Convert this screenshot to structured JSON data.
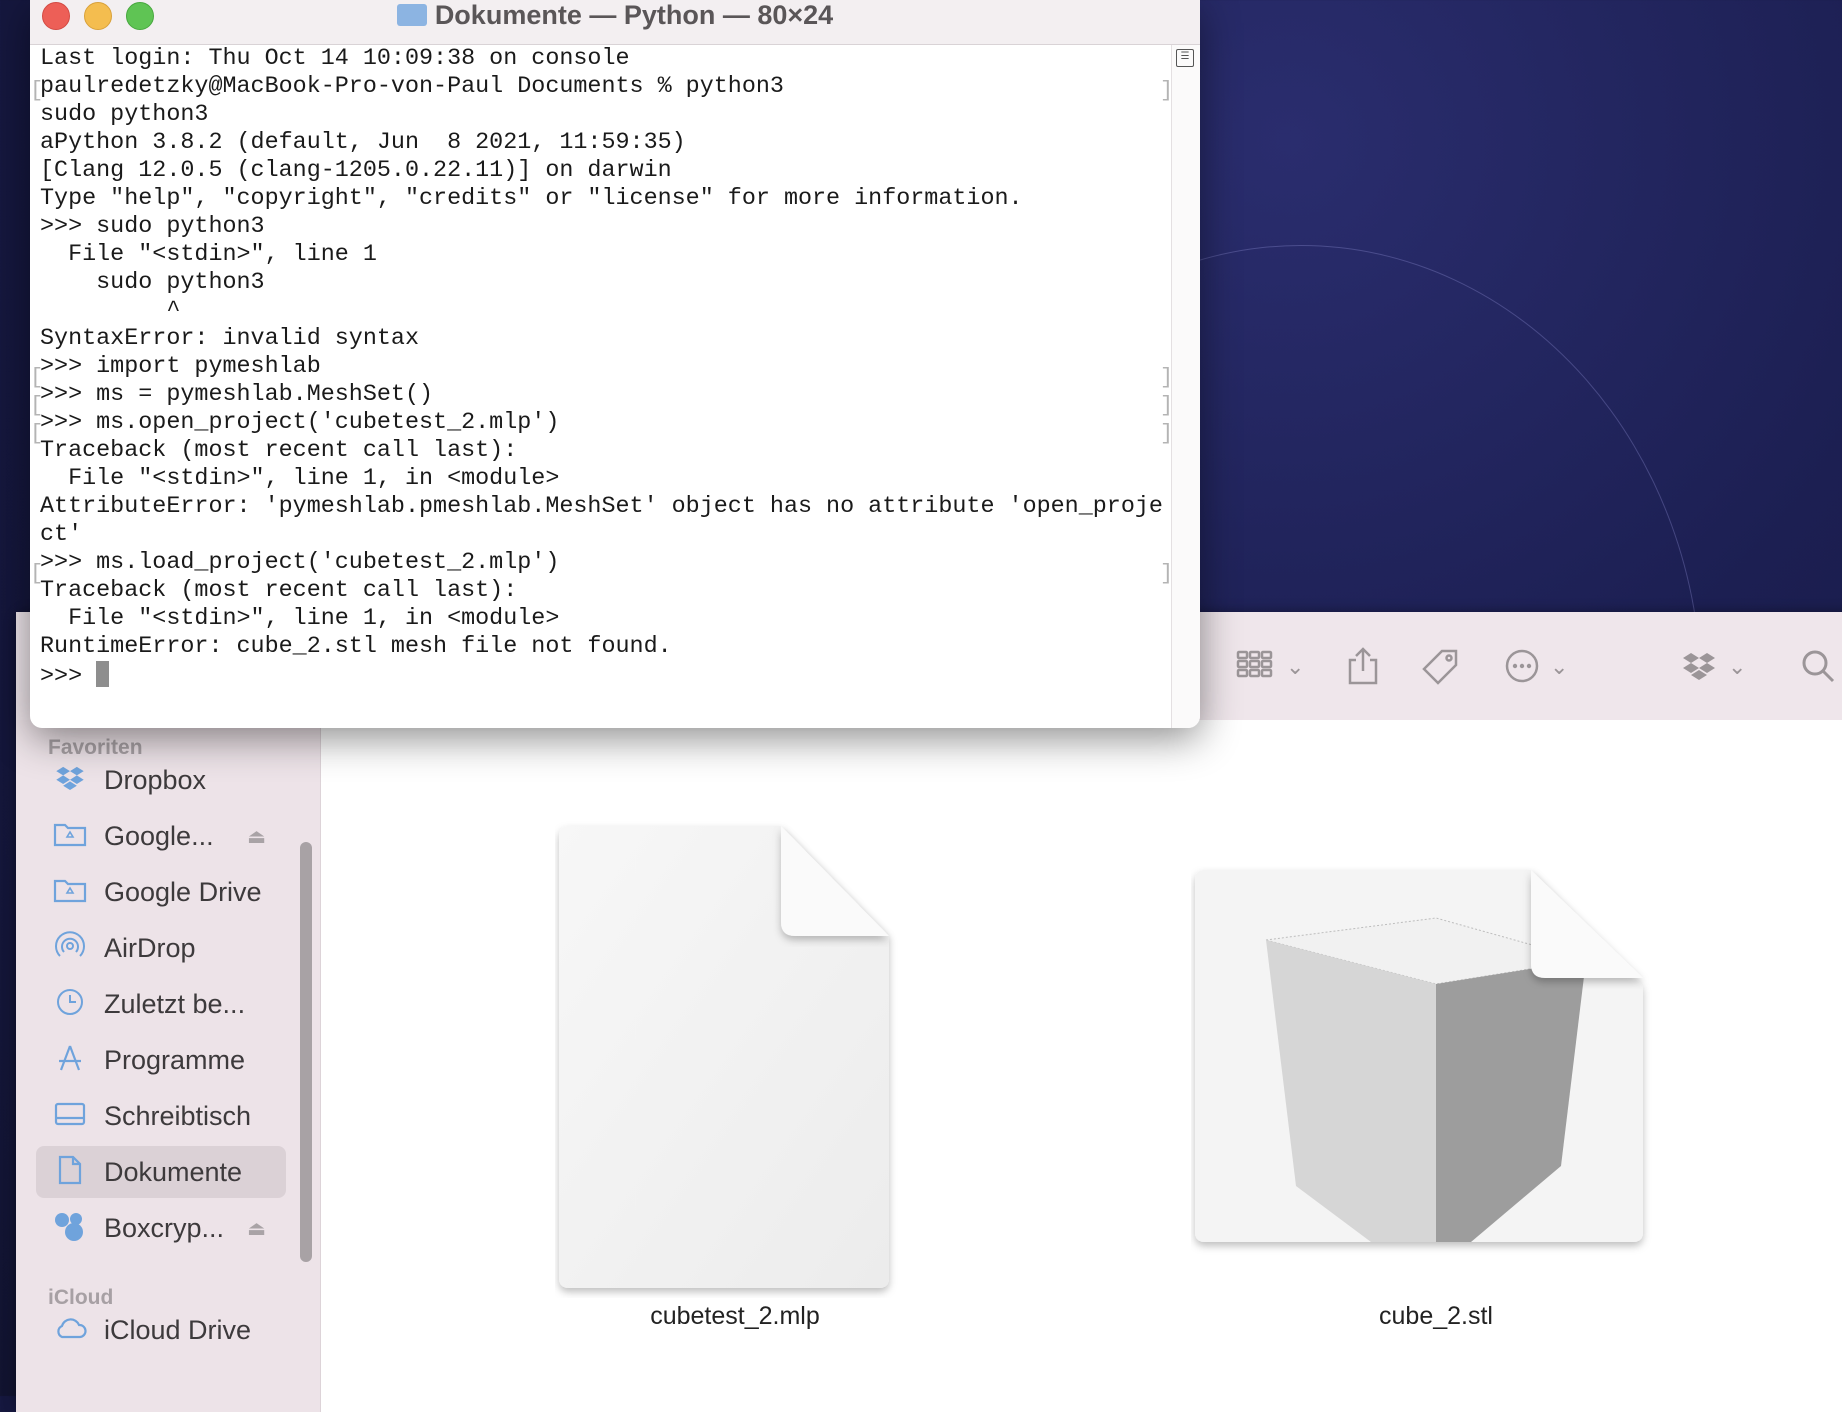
{
  "terminal": {
    "title": "Dokumente — Python — 80×24",
    "lines": [
      "Last login: Thu Oct 14 10:09:38 on console",
      "paulredetzky@MacBook-Pro-von-Paul Documents % python3",
      "sudo python3",
      "aPython 3.8.2 (default, Jun  8 2021, 11:59:35)",
      "[Clang 12.0.5 (clang-1205.0.22.11)] on darwin",
      "Type \"help\", \"copyright\", \"credits\" or \"license\" for more information.",
      ">>> sudo python3",
      "  File \"<stdin>\", line 1",
      "    sudo python3",
      "         ^",
      "SyntaxError: invalid syntax",
      ">>> import pymeshlab",
      ">>> ms = pymeshlab.MeshSet()",
      ">>> ms.open_project('cubetest_2.mlp')",
      "Traceback (most recent call last):",
      "  File \"<stdin>\", line 1, in <module>",
      "AttributeError: 'pymeshlab.pmeshlab.MeshSet' object has no attribute 'open_proje",
      "ct'",
      ">>> ms.load_project('cubetest_2.mlp')",
      "Traceback (most recent call last):",
      "  File \"<stdin>\", line 1, in <module>",
      "RuntimeError: cube_2.stl mesh file not found.",
      ">>> "
    ]
  },
  "sidebar": {
    "favorites_header": "Favoriten",
    "icloud_header": "iCloud",
    "items": [
      {
        "label": "Dropbox",
        "icon": "dropbox-icon"
      },
      {
        "label": "Google...",
        "icon": "folder-icon",
        "eject": true
      },
      {
        "label": "Google Drive",
        "icon": "folder-icon"
      },
      {
        "label": "AirDrop",
        "icon": "airdrop-icon"
      },
      {
        "label": "Zuletzt be...",
        "icon": "clock-icon"
      },
      {
        "label": "Programme",
        "icon": "applications-icon"
      },
      {
        "label": "Schreibtisch",
        "icon": "desktop-icon"
      },
      {
        "label": "Dokumente",
        "icon": "document-icon",
        "selected": true
      },
      {
        "label": "Boxcryp...",
        "icon": "boxcryptor-icon",
        "eject": true
      }
    ],
    "icloud_items": [
      {
        "label": "iCloud Drive",
        "icon": "cloud-icon"
      }
    ]
  },
  "files": [
    {
      "name": "cubetest_2.mlp",
      "icon": "generic-document-icon"
    },
    {
      "name": "cube_2.stl",
      "icon": "cube-preview-icon"
    }
  ]
}
